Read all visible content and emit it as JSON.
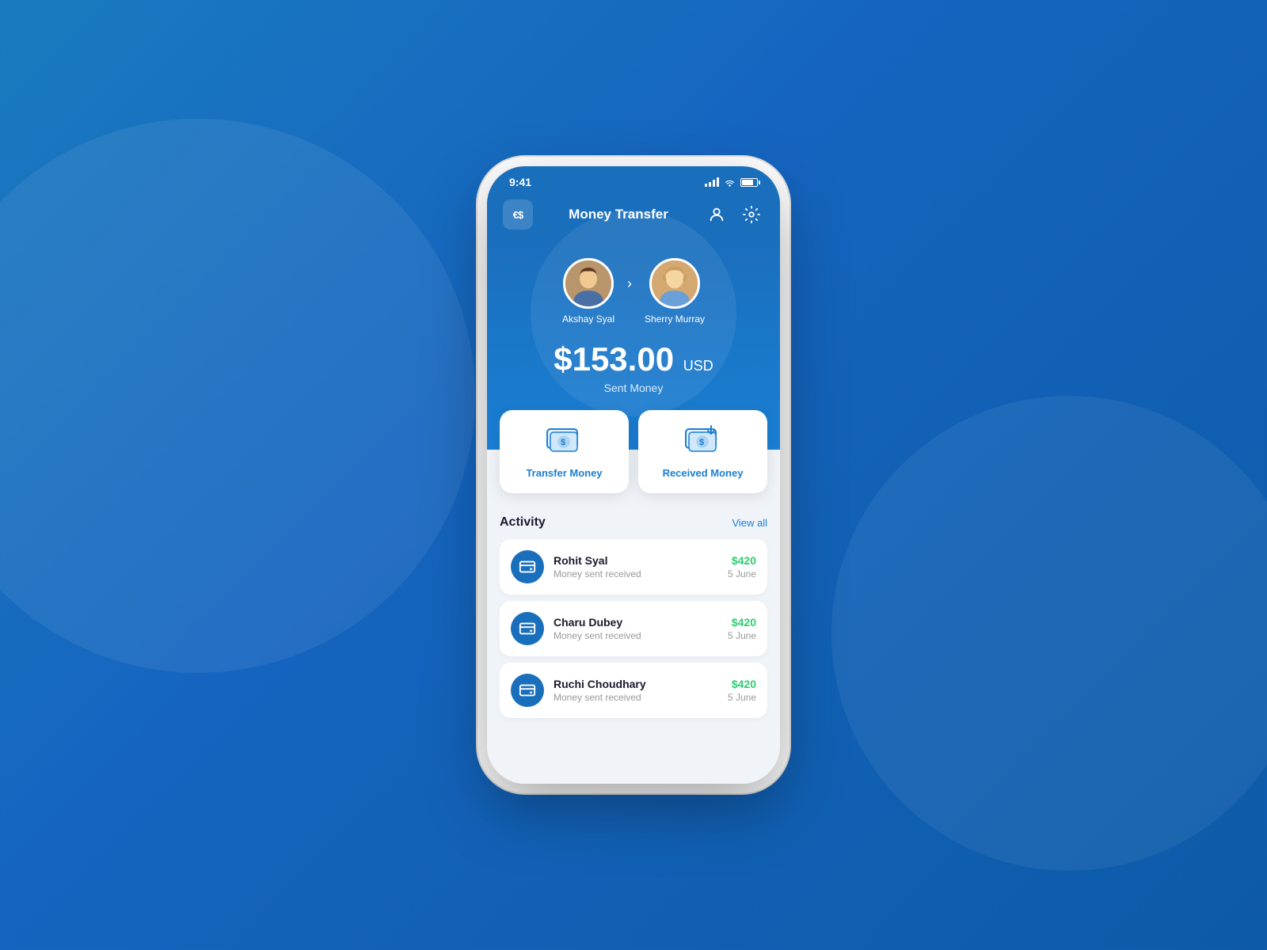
{
  "background": {
    "color_start": "#1a7abf",
    "color_end": "#0d5aa7"
  },
  "phone": {
    "status_bar": {
      "time": "9:41",
      "signal_bars": 4,
      "battery_percent": 80
    },
    "header": {
      "logo_text": "€$",
      "title": "Money Transfer",
      "profile_icon": "👤",
      "settings_icon": "⚙"
    },
    "transfer": {
      "sender": {
        "name": "Akshay Syal",
        "avatar_type": "male"
      },
      "receiver": {
        "name": "Sherry Murray",
        "avatar_type": "female"
      },
      "amount": "$153.00",
      "currency": "USD",
      "label": "Sent Money"
    },
    "actions": [
      {
        "id": "transfer",
        "label": "Transfer Money",
        "icon": "money-transfer"
      },
      {
        "id": "receive",
        "label": "Received Money",
        "icon": "money-receive"
      }
    ],
    "activity": {
      "title": "Activity",
      "view_all": "View all",
      "items": [
        {
          "name": "Rohit Syal",
          "description": "Money sent received",
          "amount": "$420",
          "date": "5 June"
        },
        {
          "name": "Charu Dubey",
          "description": "Money sent received",
          "amount": "$420",
          "date": "5 June"
        },
        {
          "name": "Ruchi Choudhary",
          "description": "Money sent received",
          "amount": "$420",
          "date": "5 June"
        }
      ]
    }
  }
}
